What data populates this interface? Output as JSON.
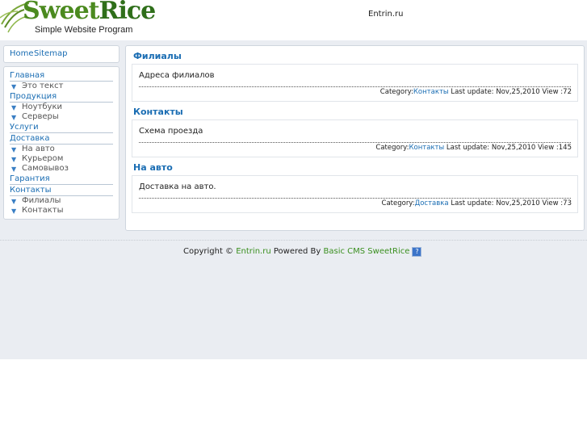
{
  "header": {
    "logo_word1": "Sweet",
    "logo_word2": "Rice",
    "logo_tagline": "Simple Website Program",
    "site_name": "Entrin.ru"
  },
  "top_links": {
    "home": "Home",
    "sitemap": "Sitemap"
  },
  "nav": [
    {
      "label": "Главная",
      "children": [
        "Это текст"
      ]
    },
    {
      "label": "Продукция",
      "children": [
        "Ноутбуки",
        "Серверы"
      ]
    },
    {
      "label": "Услуги",
      "children": []
    },
    {
      "label": "Доставка",
      "children": [
        "На авто",
        "Курьером",
        "Самовывоз"
      ]
    },
    {
      "label": "Гарантия",
      "children": []
    },
    {
      "label": "Контакты",
      "children": [
        "Филиалы",
        "Контакты"
      ]
    }
  ],
  "sections": [
    {
      "title": "Филиалы",
      "body": "Адреса филиалов",
      "category_label": "Category:",
      "category": "Контакты",
      "update_label": "Last update:",
      "date": "Nov,25,2010",
      "view_label": "View :",
      "views": "72"
    },
    {
      "title": "Контакты",
      "body": "Схема проезда",
      "category_label": "Category:",
      "category": "Контакты",
      "update_label": "Last update:",
      "date": "Nov,25,2010",
      "view_label": "View :",
      "views": "145"
    },
    {
      "title": "На авто",
      "body": "Доставка на авто.",
      "category_label": "Category:",
      "category": "Доставка",
      "update_label": "Last update:",
      "date": "Nov,25,2010",
      "view_label": "View :",
      "views": "73"
    }
  ],
  "footer": {
    "copyright": "Copyright © ",
    "site_link": "Entrin.ru",
    "powered": " Powered By ",
    "cms_link": "Basic CMS SweetRice",
    "help_icon": "help-icon"
  },
  "colors": {
    "link": "#1a6db3",
    "footer_link": "#3a8f1f",
    "logo_green": "#4b8a1f",
    "background_gray": "#eaedf2"
  }
}
